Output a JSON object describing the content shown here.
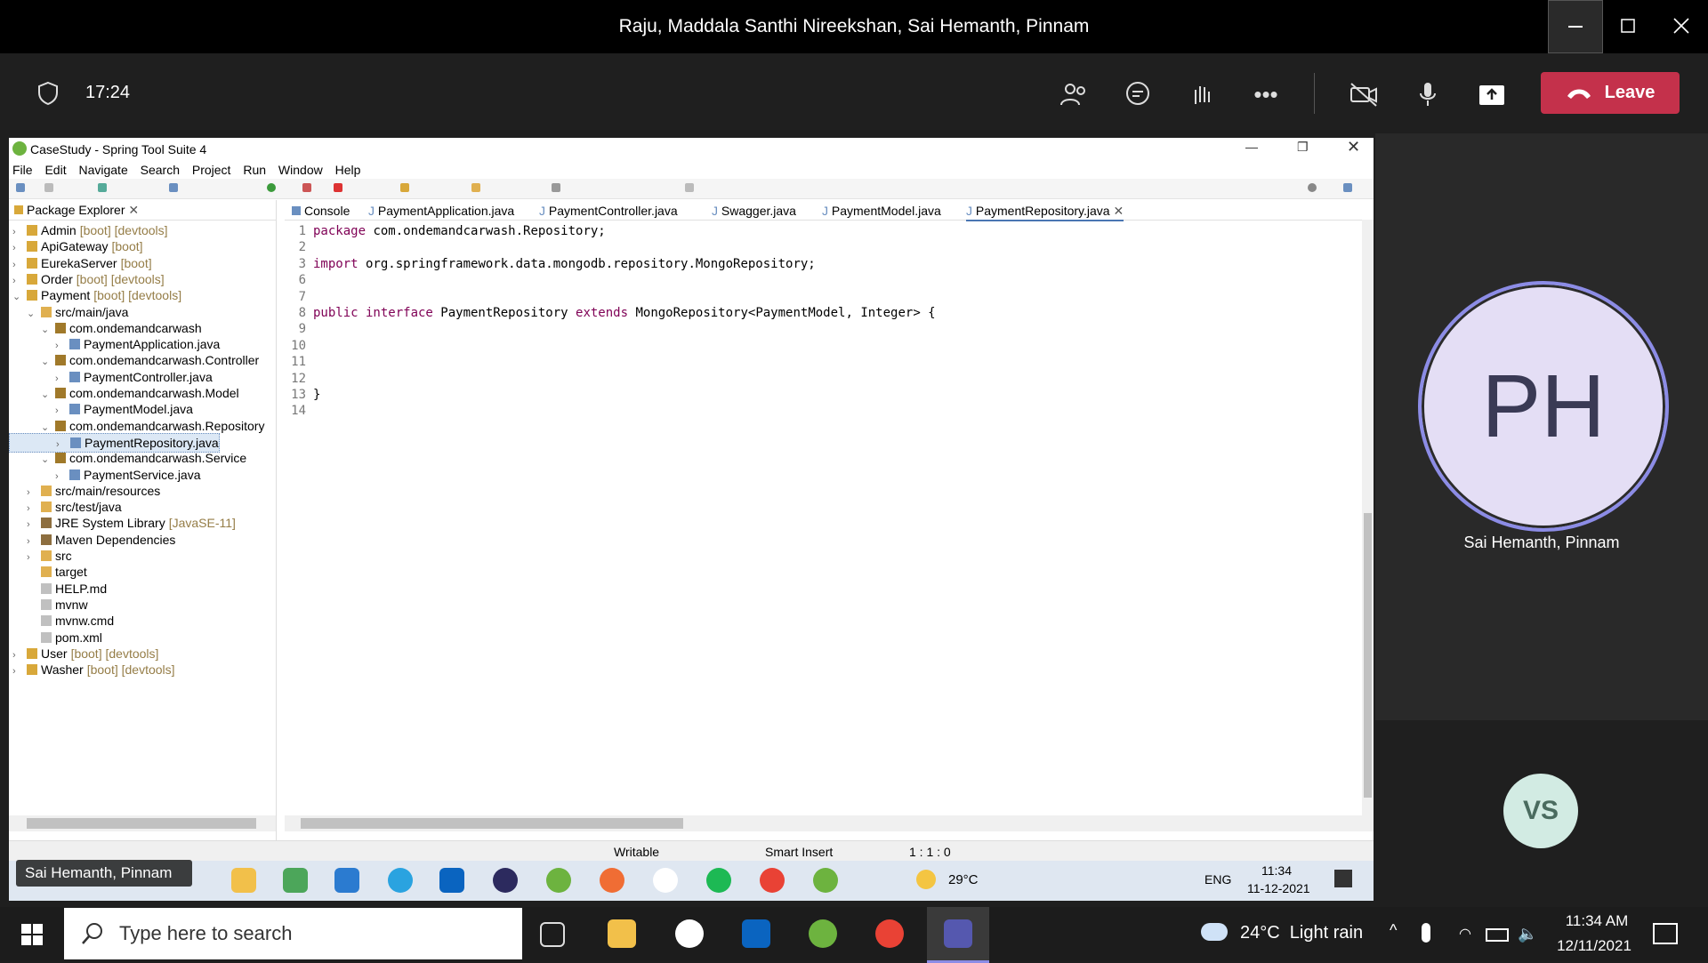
{
  "teams": {
    "window_title": "Raju, Maddala Santhi Nireekshan, Sai Hemanth, Pinnam",
    "time": "17:24",
    "leave_label": "Leave"
  },
  "sts": {
    "title": "CaseStudy - Spring Tool Suite 4",
    "menu": [
      "File",
      "Edit",
      "Navigate",
      "Search",
      "Project",
      "Run",
      "Window",
      "Help"
    ],
    "package_explorer": {
      "title": "Package Explorer",
      "tree": [
        {
          "label": "Admin",
          "deco": "[boot] [devtools]"
        },
        {
          "label": "ApiGateway",
          "deco": "[boot]"
        },
        {
          "label": "EurekaServer",
          "deco": "[boot]"
        },
        {
          "label": "Order",
          "deco": "[boot] [devtools]"
        },
        {
          "label": "Payment",
          "deco": "[boot] [devtools]"
        },
        {
          "label": "src/main/java",
          "deco": ""
        },
        {
          "label": "com.ondemandcarwash",
          "deco": ""
        },
        {
          "label": "PaymentApplication.java",
          "deco": ""
        },
        {
          "label": "com.ondemandcarwash.Controller",
          "deco": ""
        },
        {
          "label": "PaymentController.java",
          "deco": ""
        },
        {
          "label": "com.ondemandcarwash.Model",
          "deco": ""
        },
        {
          "label": "PaymentModel.java",
          "deco": ""
        },
        {
          "label": "com.ondemandcarwash.Repository",
          "deco": ""
        },
        {
          "label": "PaymentRepository.java",
          "deco": ""
        },
        {
          "label": "com.ondemandcarwash.Service",
          "deco": ""
        },
        {
          "label": "PaymentService.java",
          "deco": ""
        },
        {
          "label": "src/main/resources",
          "deco": ""
        },
        {
          "label": "src/test/java",
          "deco": ""
        },
        {
          "label": "JRE System Library",
          "deco": "[JavaSE-11]"
        },
        {
          "label": "Maven Dependencies",
          "deco": ""
        },
        {
          "label": "src",
          "deco": ""
        },
        {
          "label": "target",
          "deco": ""
        },
        {
          "label": "HELP.md",
          "deco": ""
        },
        {
          "label": "mvnw",
          "deco": ""
        },
        {
          "label": "mvnw.cmd",
          "deco": ""
        },
        {
          "label": "pom.xml",
          "deco": ""
        },
        {
          "label": "User",
          "deco": "[boot] [devtools]"
        },
        {
          "label": "Washer",
          "deco": "[boot] [devtools]"
        }
      ]
    },
    "tabs": [
      "Console",
      "PaymentApplication.java",
      "PaymentController.java",
      "Swagger.java",
      "PaymentModel.java",
      "PaymentRepository.java"
    ],
    "code": [
      {
        "n": "1",
        "kw": "package",
        "rest": " com.ondemandcarwash.Repository;"
      },
      {
        "n": "2",
        "kw": "",
        "rest": ""
      },
      {
        "n": "3",
        "kw": "import",
        "rest": " org.springframework.data.mongodb.repository.MongoRepository;"
      },
      {
        "n": "6",
        "kw": "",
        "rest": ""
      },
      {
        "n": "7",
        "kw": "",
        "rest": ""
      },
      {
        "n": "8",
        "kw": "public interface",
        "rest": " PaymentRepository ",
        "kw2": "extends",
        "rest2": " MongoRepository<PaymentModel, Integer> {"
      },
      {
        "n": "9",
        "kw": "",
        "rest": ""
      },
      {
        "n": "10",
        "kw": "",
        "rest": ""
      },
      {
        "n": "11",
        "kw": "",
        "rest": ""
      },
      {
        "n": "12",
        "kw": "",
        "rest": ""
      },
      {
        "n": "13",
        "kw": "",
        "rest": "}"
      },
      {
        "n": "14",
        "kw": "",
        "rest": ""
      }
    ],
    "status": {
      "writable": "Writable",
      "insert": "Smart Insert",
      "pos": "1 : 1 : 0"
    },
    "inner_tray": {
      "temp": "29°C",
      "lang": "ENG",
      "time": "11:34",
      "date": "11-12-2021"
    }
  },
  "participants": {
    "main_initials": "PH",
    "main_name": "Sai Hemanth, Pinnam",
    "second_initials": "VS",
    "name_tag": "Sai Hemanth, Pinnam"
  },
  "taskbar": {
    "search_placeholder": "Type here to search",
    "weather": "24°C  Light rain",
    "time": "11:34 AM",
    "date": "12/11/2021"
  },
  "colors": {
    "leave": "#c4314b",
    "keyword": "#7f0055",
    "avatar_ring": "#8c8ce6"
  }
}
